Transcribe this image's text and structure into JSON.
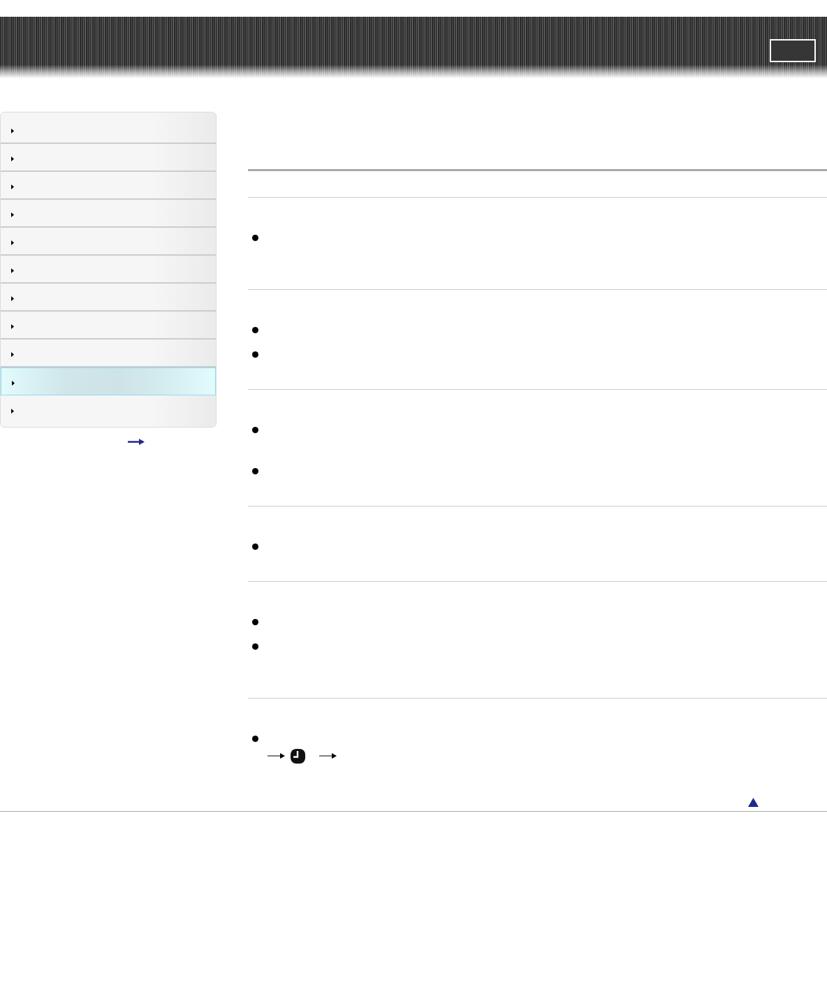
{
  "sidebar": {
    "items": [
      {
        "selected": false
      },
      {
        "selected": false
      },
      {
        "selected": false
      },
      {
        "selected": false
      },
      {
        "selected": false
      },
      {
        "selected": false
      },
      {
        "selected": false
      },
      {
        "selected": false
      },
      {
        "selected": false
      },
      {
        "selected": true
      },
      {
        "selected": false
      }
    ]
  },
  "sections": [
    {
      "bullets": [
        {
          "kind": "plain"
        }
      ]
    },
    {
      "bullets": [
        {
          "kind": "plain"
        },
        {
          "kind": "plain"
        }
      ]
    },
    {
      "bullets": [
        {
          "kind": "plain"
        },
        {
          "kind": "plain"
        }
      ]
    },
    {
      "bullets": [
        {
          "kind": "plain"
        }
      ]
    },
    {
      "bullets": [
        {
          "kind": "plain"
        },
        {
          "kind": "plain"
        }
      ]
    },
    {
      "bullets": [
        {
          "kind": "steps"
        }
      ]
    }
  ]
}
